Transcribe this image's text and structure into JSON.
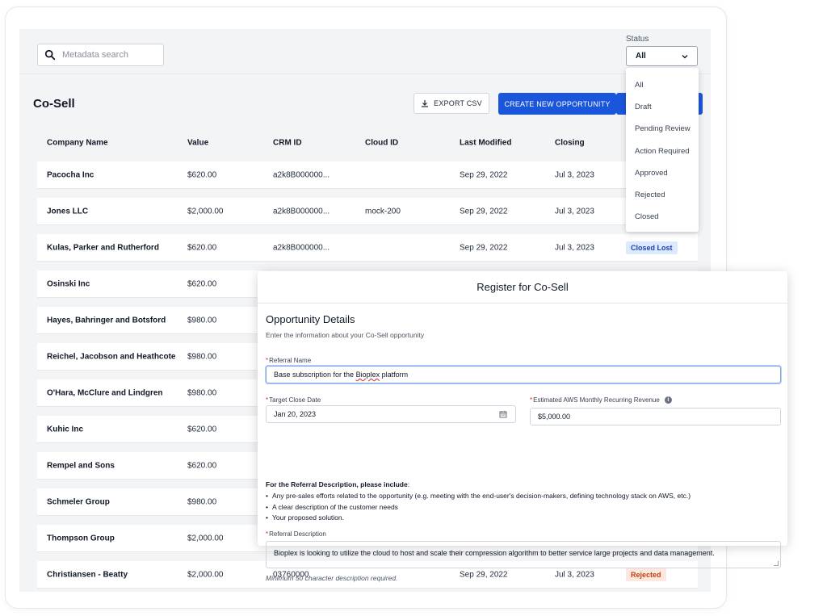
{
  "toolbar": {
    "search_placeholder": "Metadata search",
    "status_label": "Status",
    "status_value": "All"
  },
  "page": {
    "title": "Co-Sell",
    "export_label": "EXPORT CSV",
    "create_label": "CREATE NEW OPPORTUNITY"
  },
  "table": {
    "columns": [
      "Company Name",
      "Value",
      "CRM ID",
      "Cloud ID",
      "Last Modified",
      "Closing"
    ],
    "rows": [
      {
        "company": "Pacocha Inc",
        "value": "$620.00",
        "crm": "a2k8B000000...",
        "cloud": "",
        "modified": "Sep 29, 2022",
        "closing": "Jul 3, 2023",
        "status": ""
      },
      {
        "company": "Jones LLC",
        "value": "$2,000.00",
        "crm": "a2k8B000000...",
        "cloud": "mock-200",
        "modified": "Sep 29, 2022",
        "closing": "Jul 3, 2023",
        "status": ""
      },
      {
        "company": "Kulas, Parker and Rutherford",
        "value": "$620.00",
        "crm": "a2k8B000000...",
        "cloud": "",
        "modified": "Sep 29, 2022",
        "closing": "Jul 3, 2023",
        "status": "Closed Lost"
      },
      {
        "company": "Osinski Inc",
        "value": "$620.00",
        "crm": "",
        "cloud": "",
        "modified": "",
        "closing": "",
        "status": ""
      },
      {
        "company": "Hayes, Bahringer and Botsford",
        "value": "$980.00",
        "crm": "",
        "cloud": "",
        "modified": "",
        "closing": "",
        "status": ""
      },
      {
        "company": "Reichel, Jacobson and Heathcote",
        "value": "$980.00",
        "crm": "",
        "cloud": "",
        "modified": "",
        "closing": "",
        "status": ""
      },
      {
        "company": "O'Hara, McClure and Lindgren",
        "value": "$980.00",
        "crm": "",
        "cloud": "",
        "modified": "",
        "closing": "",
        "status": ""
      },
      {
        "company": "Kuhic Inc",
        "value": "$620.00",
        "crm": "",
        "cloud": "",
        "modified": "",
        "closing": "",
        "status": ""
      },
      {
        "company": "Rempel and Sons",
        "value": "$620.00",
        "crm": "",
        "cloud": "",
        "modified": "",
        "closing": "",
        "status": ""
      },
      {
        "company": "Schmeler Group",
        "value": "$980.00",
        "crm": "",
        "cloud": "",
        "modified": "",
        "closing": "",
        "status": ""
      },
      {
        "company": "Thompson Group",
        "value": "$2,000.00",
        "crm": "",
        "cloud": "",
        "modified": "",
        "closing": "",
        "status": ""
      },
      {
        "company": "Christiansen - Beatty",
        "value": "$2,000.00",
        "crm": "03760000",
        "cloud": "",
        "modified": "Sep 29, 2022",
        "closing": "Jul 3, 2023",
        "status": "Rejected"
      }
    ]
  },
  "status_options": [
    "All",
    "Draft",
    "Pending Review",
    "Action Required",
    "Approved",
    "Rejected",
    "Closed"
  ],
  "badge_colors": {
    "Closed Lost": {
      "bg": "#dbeafe",
      "fg": "#1e40af"
    },
    "Rejected": {
      "bg": "#fde8e1",
      "fg": "#c2410c"
    }
  },
  "modal": {
    "title": "Register for Co-Sell",
    "section_title": "Opportunity Details",
    "section_subtitle": "Enter the information about your Co-Sell opportunity",
    "referral_name_label": "Referral Name",
    "referral_name_value_prefix": "Base subscription for the ",
    "referral_name_value_word": "Bioplex",
    "referral_name_value_suffix": " platform",
    "close_date_label": "Target Close Date",
    "close_date_value": "Jan 20, 2023",
    "revenue_label": "Estimated AWS Monthly Recurring Revenue",
    "revenue_value": "$5,000.00",
    "instructions_heading": "For the Referral Description, please include",
    "instructions_colon": ":",
    "instructions": [
      "Any pre-sales efforts related to the opportunity (e.g. meeting with the end-user's decision-makers, defining technology stack on AWS, etc.)",
      "A clear description of the customer needs",
      "Your proposed solution."
    ],
    "description_label": "Referral Description",
    "description_value": "Bioplex is looking to utilize the cloud to host and scale their compression algorithm to better service large projects and data management.",
    "description_hint": "Minimum 50 character description required.",
    "required_mark": "*"
  }
}
